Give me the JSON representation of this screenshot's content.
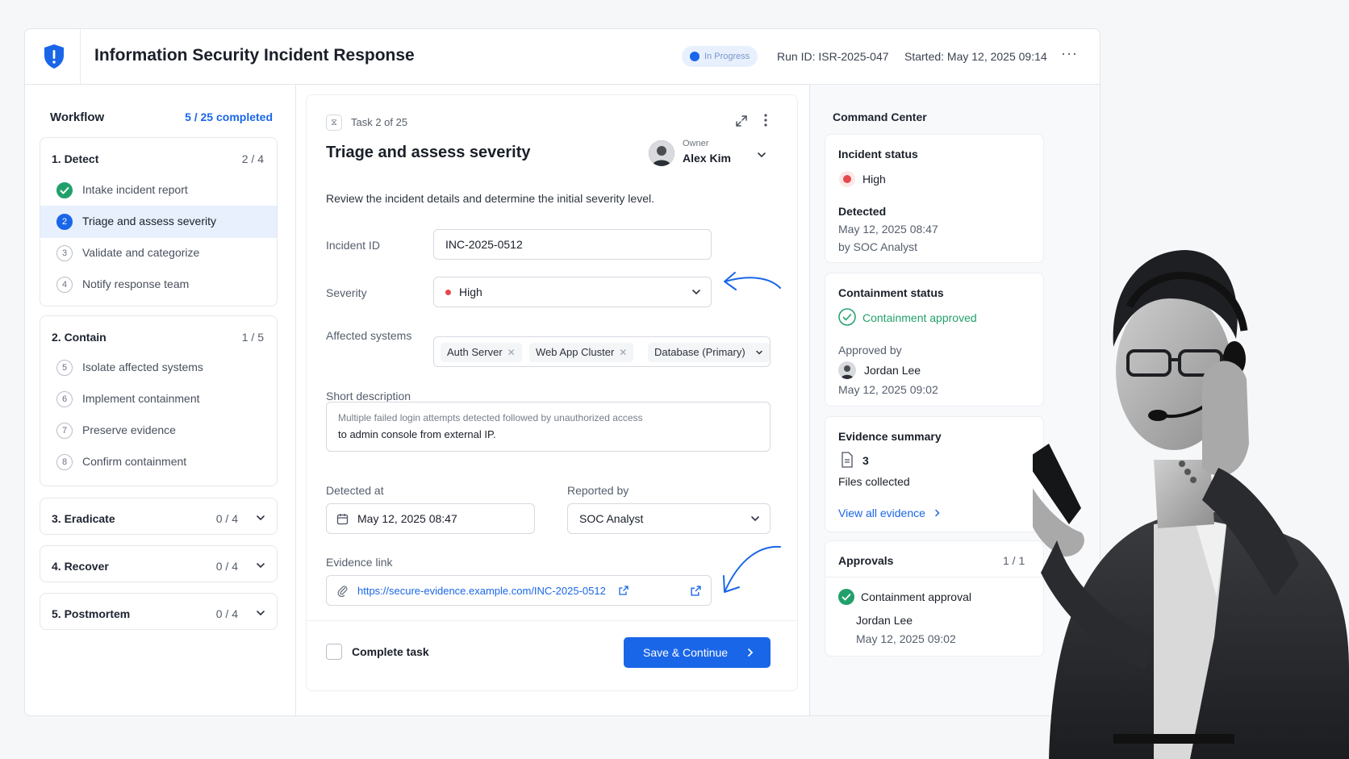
{
  "header": {
    "title": "Information Security Incident Response",
    "status": "In Progress",
    "run_id": "Run ID: ISR-2025-047",
    "started": "Started: May 12, 2025 09:14",
    "more": "···"
  },
  "workflow": {
    "title": "Workflow",
    "completed": "5 / 25 completed",
    "stages": [
      {
        "name": "1. Detect",
        "count": "2 / 4",
        "steps": [
          {
            "num": "1",
            "label": "Intake incident report",
            "state": "done"
          },
          {
            "num": "2",
            "label": "Triage and assess severity",
            "state": "current"
          },
          {
            "num": "3",
            "label": "Validate and categorize",
            "state": "pending"
          },
          {
            "num": "4",
            "label": "Notify response team",
            "state": "pending"
          }
        ]
      },
      {
        "name": "2. Contain",
        "count": "1 / 5",
        "steps": [
          {
            "num": "5",
            "label": "Isolate affected systems",
            "state": "pending"
          },
          {
            "num": "6",
            "label": "Implement containment",
            "state": "pending"
          },
          {
            "num": "7",
            "label": "Preserve evidence",
            "state": "pending"
          },
          {
            "num": "8",
            "label": "Confirm containment",
            "state": "pending"
          }
        ]
      },
      {
        "name": "3. Eradicate",
        "count": "0 / 4"
      },
      {
        "name": "4. Recover",
        "count": "0 / 4"
      },
      {
        "name": "5. Postmortem",
        "count": "0 / 4"
      }
    ]
  },
  "task": {
    "icon": "hourglass-icon",
    "position": "Task 2 of 25",
    "title": "Triage and assess severity",
    "owner_label": "Owner",
    "owner_name": "Alex Kim",
    "description": "Review the incident details and determine the initial severity level.",
    "incident_id_label": "Incident ID",
    "incident_id": "INC-2025-0512",
    "severity_label": "Severity",
    "severity": "High",
    "affected_label": "Affected systems",
    "affected_systems": [
      "Auth Server",
      "Web App Cluster",
      "Database (Primary)"
    ],
    "short_desc_label": "Short description",
    "short_desc_line1": "Multiple failed login attempts detected followed by unauthorized access",
    "short_desc_line2": "to admin console from external IP.",
    "detected_label": "Detected at",
    "detected_at": "May 12, 2025 08:47",
    "reported_label": "Reported by",
    "reported_by": "SOC Analyst",
    "evidence_label": "Evidence link",
    "evidence_link": "https://secure-evidence.example.com/INC-2025-0512",
    "complete_label": "Complete task",
    "save_label": "Save & Continue"
  },
  "command_center": {
    "title": "Command Center",
    "incident_status": {
      "title": "Incident status",
      "level": "High",
      "detected_label": "Detected",
      "detected_date": "May 12, 2025 08:47",
      "detected_by": "by SOC Analyst"
    },
    "containment": {
      "title": "Containment status",
      "status": "Containment approved",
      "approved_by_label": "Approved by",
      "approver": "Jordan Lee",
      "date": "May 12, 2025 09:02"
    },
    "evidence": {
      "title": "Evidence summary",
      "count": "3",
      "files_label": "Files collected",
      "view_all": "View all evidence"
    },
    "approvals": {
      "title": "Approvals",
      "count": "1 / 1",
      "item": "Containment approval",
      "approver": "Jordan Lee",
      "date": "May 12, 2025 09:02"
    }
  },
  "colors": {
    "accent": "#1a66e8",
    "success": "#22a06b",
    "danger": "#e5484d"
  }
}
